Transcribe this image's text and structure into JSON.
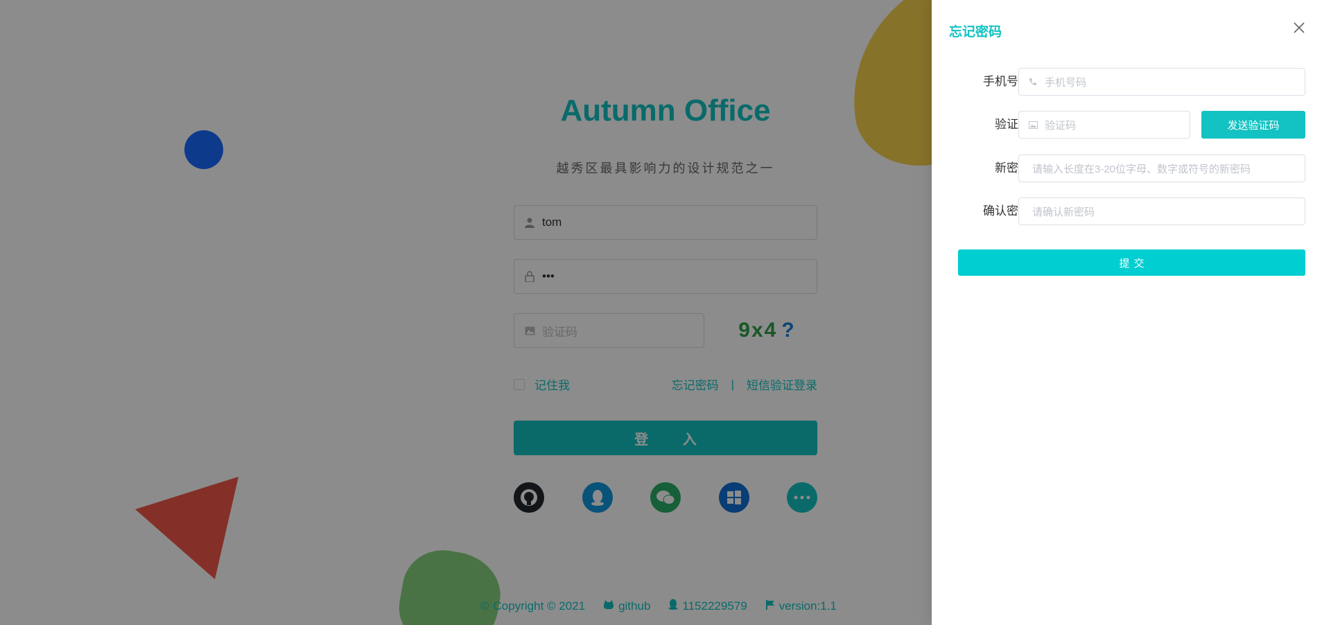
{
  "colors": {
    "accent": "#13c2c2",
    "submit": "#00ced1",
    "mask": "rgba(0,0,0,0.45)",
    "deco_blue": "#1a6bff",
    "deco_yellow": "#f6d04d",
    "deco_red": "#f0584a",
    "deco_green": "#88d27f"
  },
  "login": {
    "title": "Autumn Office",
    "subtitle": "越秀区最具影响力的设计规范之一",
    "username_value": "tom",
    "password_value": "•••",
    "captcha_placeholder": "验证码",
    "captcha_text": "9x4",
    "remember_label": "记住我",
    "forgot_link": "忘记密码",
    "separator": "|",
    "sms_link": "短信验证登录",
    "login_button": "登 入",
    "socials": [
      "github-icon",
      "qq-icon",
      "wechat-icon",
      "windows-icon",
      "more-icon"
    ],
    "footer": {
      "copyright": "Copyright © 2021",
      "github": "github",
      "qq": "1152229579",
      "version": "version:1.1"
    }
  },
  "drawer": {
    "title": "忘记密码",
    "phone_label": "手机号码",
    "phone_placeholder": "手机号码",
    "code_label": "验证码",
    "code_placeholder": "验证码",
    "send_code_button": "发送验证码",
    "new_password_label": "新密码",
    "new_password_placeholder": "请输入长度在3-20位字母、数字或符号的新密码",
    "confirm_password_label": "确认密码",
    "confirm_password_placeholder": "请确认新密码",
    "submit_button": "提交"
  }
}
